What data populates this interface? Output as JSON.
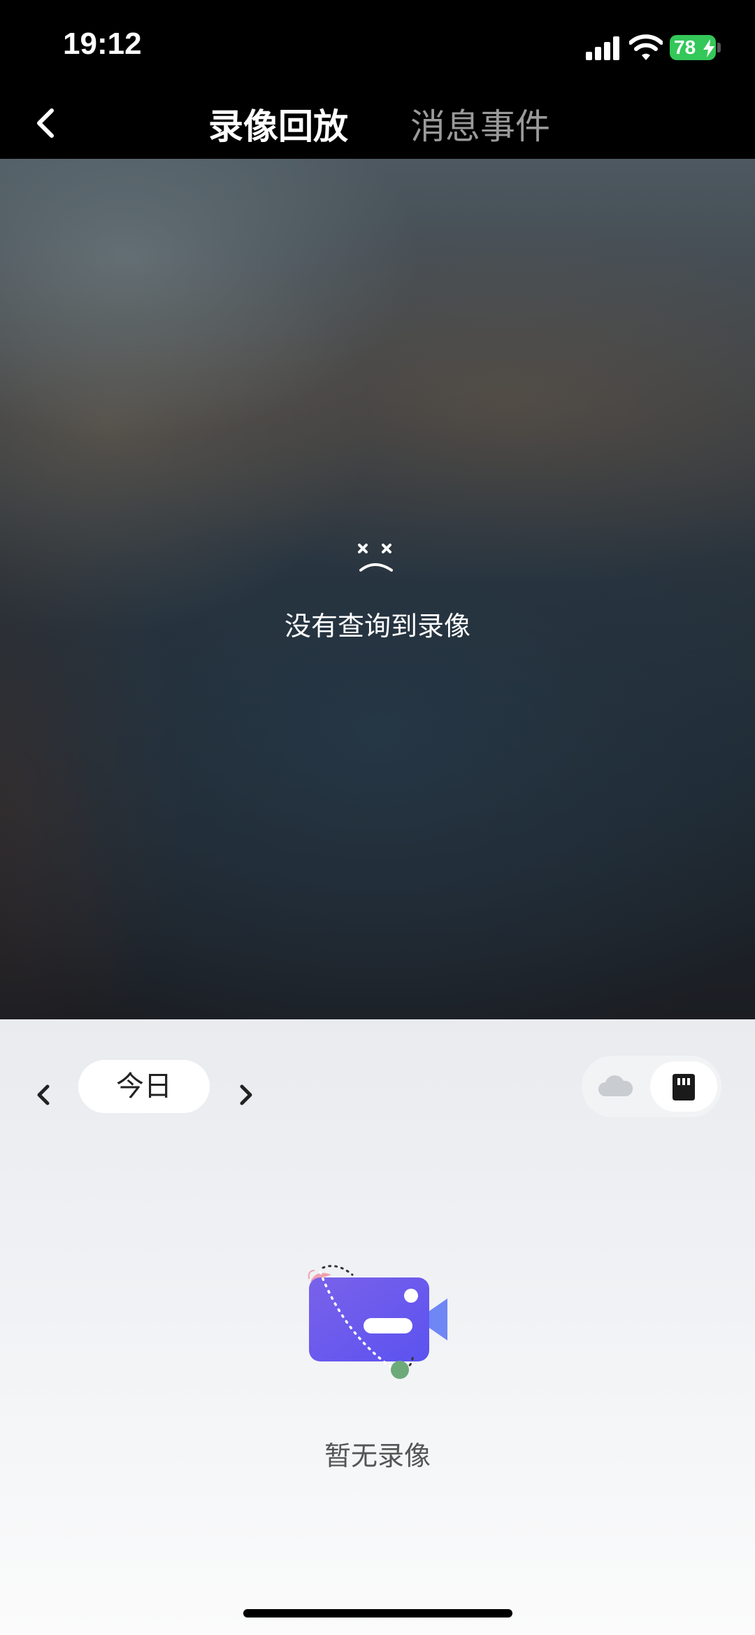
{
  "status_bar": {
    "time": "19:12",
    "battery": "78"
  },
  "nav": {
    "tab_active": "录像回放",
    "tab_inactive": "消息事件"
  },
  "player": {
    "message": "没有查询到录像"
  },
  "date_bar": {
    "day_label": "今日"
  },
  "storage": {
    "options": [
      "cloud",
      "sd-card"
    ],
    "selected": "sd-card"
  },
  "empty_state": {
    "text": "暂无录像"
  },
  "icons": {
    "back": "chevron-left-icon",
    "prev": "chevron-left-icon",
    "next": "chevron-right-icon",
    "cloud": "cloud-icon",
    "sd": "sd-card-icon",
    "empty": "video-camera-icon",
    "error": "sad-face-icon"
  },
  "colors": {
    "battery": "#34c759",
    "camera": "#6a5cf0"
  }
}
